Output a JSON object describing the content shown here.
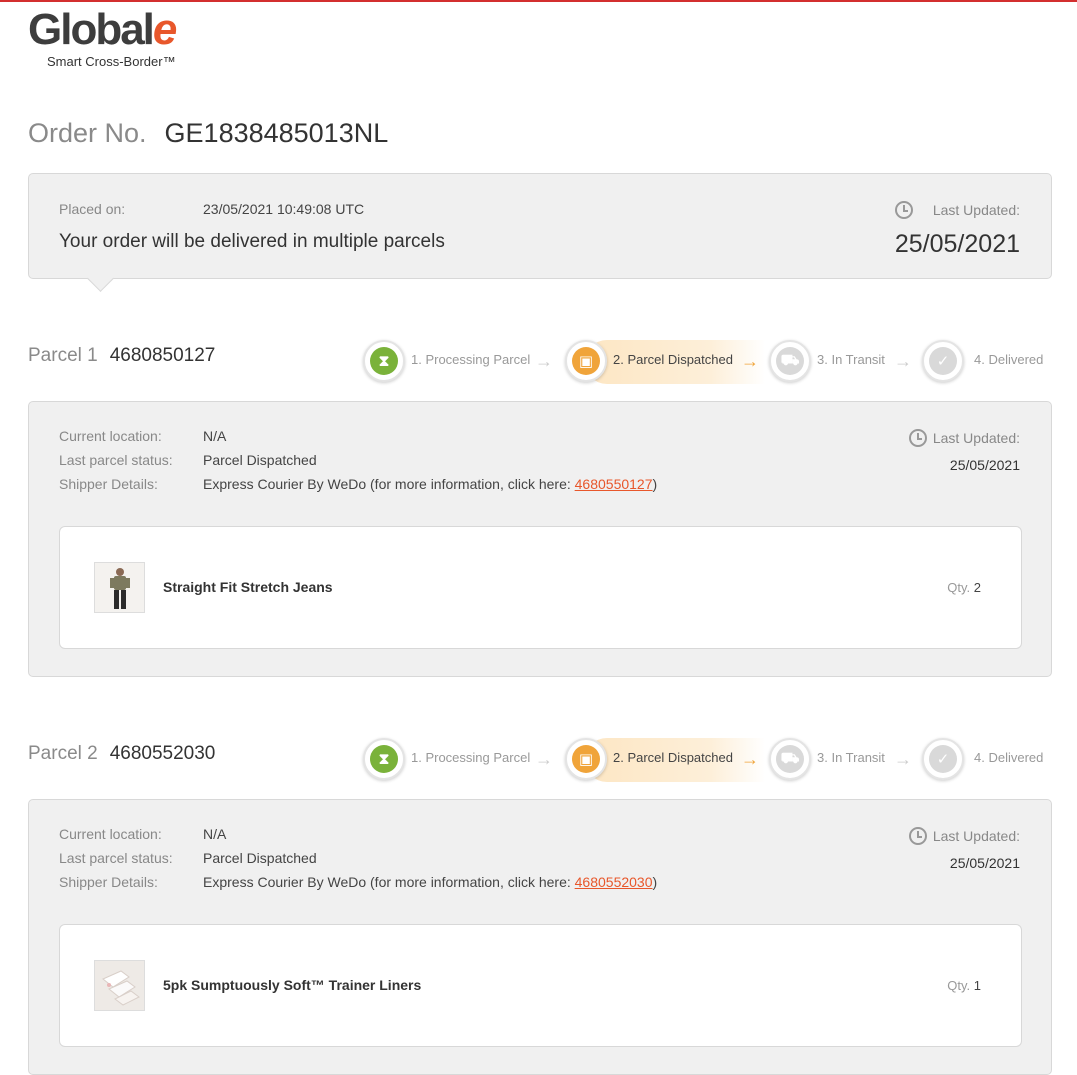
{
  "brand": {
    "name_main": "Global",
    "name_e": "e",
    "tagline": "Smart Cross-Border™"
  },
  "order": {
    "label": "Order No.",
    "number": "GE1838485013NL"
  },
  "summary": {
    "placed_label": "Placed on:",
    "placed_value": "23/05/2021 10:49:08 UTC",
    "message": "Your order will be delivered in multiple parcels",
    "last_updated_label": "Last Updated:",
    "last_updated_date": "25/05/2021"
  },
  "steps": [
    {
      "label": "1. Processing Parcel",
      "icon": "hourglass-icon"
    },
    {
      "label": "2. Parcel Dispatched",
      "icon": "box-icon"
    },
    {
      "label": "3. In Transit",
      "icon": "truck-icon"
    },
    {
      "label": "4. Delivered",
      "icon": "check-icon"
    }
  ],
  "labels": {
    "current_location": "Current location:",
    "last_status": "Last parcel status:",
    "shipper": "Shipper Details:",
    "last_updated": "Last Updated:",
    "qty": "Qty."
  },
  "parcels": [
    {
      "label": "Parcel 1",
      "number": "4680850127",
      "current_step": 2,
      "location": "N/A",
      "status": "Parcel Dispatched",
      "shipper_text": "Express Courier By WeDo (for more information, click here: ",
      "tracking_link": "4680550127",
      "shipper_close": ")",
      "updated_date": "25/05/2021",
      "item": {
        "name": "Straight Fit Stretch Jeans",
        "qty": "2",
        "thumb": "person-jeans"
      }
    },
    {
      "label": "Parcel 2",
      "number": "4680552030",
      "current_step": 2,
      "location": "N/A",
      "status": "Parcel Dispatched",
      "shipper_text": "Express Courier By WeDo (for more information, click here: ",
      "tracking_link": "4680552030",
      "shipper_close": ")",
      "updated_date": "25/05/2021",
      "item": {
        "name": "5pk Sumptuously Soft™ Trainer Liners",
        "qty": "1",
        "thumb": "socks"
      }
    }
  ],
  "colors": {
    "accent": "#e8572b",
    "done": "#7ab23a",
    "active": "#f0a43a",
    "pending": "#d9d9d9",
    "top_bar": "#d32f2f"
  }
}
